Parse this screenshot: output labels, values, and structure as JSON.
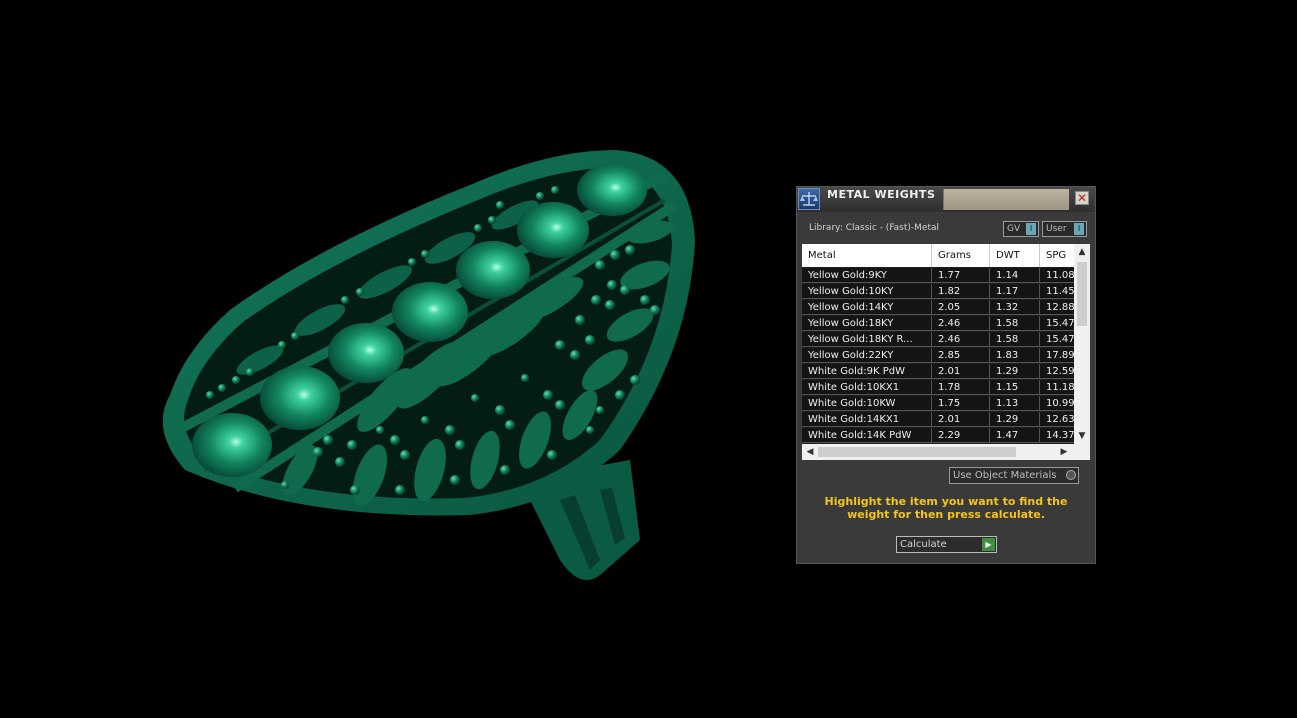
{
  "dialog": {
    "title": "METAL WEIGHTS",
    "close_symbol": "✕",
    "library_label": "Library: Classic - (Fast)-Metal",
    "gv_label": "GV",
    "user_label": "User",
    "toggle_symbol": "I",
    "use_object_materials": "Use Object Materials",
    "instruction": "Highlight the item you want to find the weight for then press calculate.",
    "calculate_label": "Calculate",
    "calculate_symbol": "▶"
  },
  "table": {
    "columns": [
      "Metal",
      "Grams",
      "DWT",
      "SPG"
    ],
    "rows": [
      [
        "Yellow Gold:9KY",
        "1.77",
        "1.14",
        "11.08"
      ],
      [
        "Yellow Gold:10KY",
        "1.82",
        "1.17",
        "11.45"
      ],
      [
        "Yellow Gold:14KY",
        "2.05",
        "1.32",
        "12.88"
      ],
      [
        "Yellow Gold:18KY",
        "2.46",
        "1.58",
        "15.47"
      ],
      [
        "Yellow Gold:18KY R...",
        "2.46",
        "1.58",
        "15.47"
      ],
      [
        "Yellow Gold:22KY",
        "2.85",
        "1.83",
        "17.89"
      ],
      [
        "White Gold:9K PdW",
        "2.01",
        "1.29",
        "12.59"
      ],
      [
        "White Gold:10KX1",
        "1.78",
        "1.15",
        "11.18"
      ],
      [
        "White Gold:10KW",
        "1.75",
        "1.13",
        "10.99"
      ],
      [
        "White Gold:14KX1",
        "2.01",
        "1.29",
        "12.63"
      ],
      [
        "White Gold:14K PdW",
        "2.29",
        "1.47",
        "14.37"
      ]
    ]
  },
  "colors": {
    "model_green": "#0f6a4e",
    "instruction_yellow": "#f5c518",
    "background": "#000000"
  }
}
